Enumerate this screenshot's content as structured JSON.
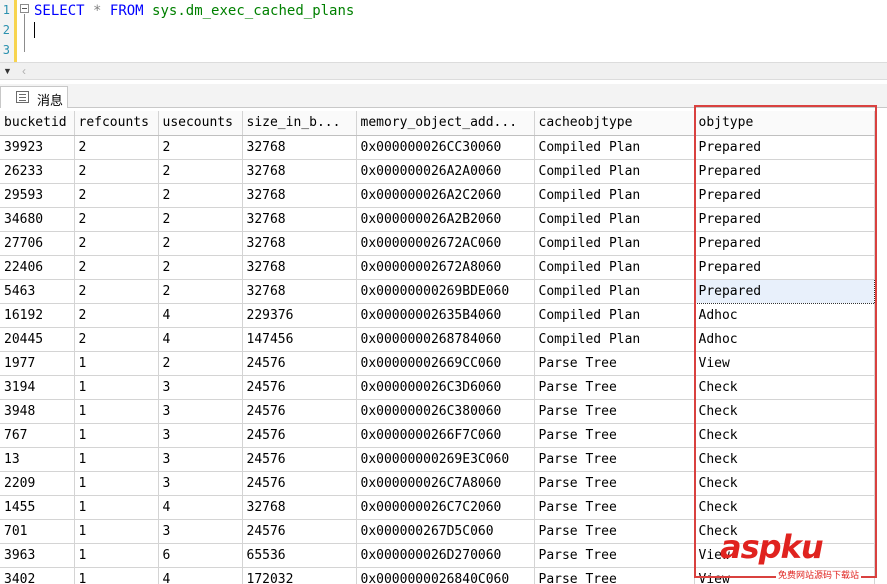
{
  "editor": {
    "line_numbers": [
      "1",
      "2",
      "3"
    ],
    "query": {
      "keyword_select": "SELECT",
      "star": "*",
      "keyword_from": "FROM",
      "object": "sys.dm_exec_cached_plans"
    }
  },
  "results_tab": {
    "label": "消息"
  },
  "grid": {
    "columns": [
      "bucketid",
      "refcounts",
      "usecounts",
      "size_in_b...",
      "memory_object_add...",
      "cacheobjtype",
      "objtype"
    ],
    "rows": [
      [
        "39923",
        "2",
        "2",
        "32768",
        "0x000000026CC30060",
        "Compiled Plan",
        "Prepared"
      ],
      [
        "26233",
        "2",
        "2",
        "32768",
        "0x000000026A2A0060",
        "Compiled Plan",
        "Prepared"
      ],
      [
        "29593",
        "2",
        "2",
        "32768",
        "0x000000026A2C2060",
        "Compiled Plan",
        "Prepared"
      ],
      [
        "34680",
        "2",
        "2",
        "32768",
        "0x000000026A2B2060",
        "Compiled Plan",
        "Prepared"
      ],
      [
        "27706",
        "2",
        "2",
        "32768",
        "0x00000002672AC060",
        "Compiled Plan",
        "Prepared"
      ],
      [
        "22406",
        "2",
        "2",
        "32768",
        "0x00000002672A8060",
        "Compiled Plan",
        "Prepared"
      ],
      [
        "5463",
        "2",
        "2",
        "32768",
        "0x00000000269BDE060",
        "Compiled Plan",
        "Prepared"
      ],
      [
        "16192",
        "2",
        "4",
        "229376",
        "0x00000002635B4060",
        "Compiled Plan",
        "Adhoc"
      ],
      [
        "20445",
        "2",
        "4",
        "147456",
        "0x0000000268784060",
        "Compiled Plan",
        "Adhoc"
      ],
      [
        "1977",
        "1",
        "2",
        "24576",
        "0x00000002669CC060",
        "Parse Tree",
        "View"
      ],
      [
        "3194",
        "1",
        "3",
        "24576",
        "0x000000026C3D6060",
        "Parse Tree",
        "Check"
      ],
      [
        "3948",
        "1",
        "3",
        "24576",
        "0x000000026C380060",
        "Parse Tree",
        "Check"
      ],
      [
        "767",
        "1",
        "3",
        "24576",
        "0x0000000266F7C060",
        "Parse Tree",
        "Check"
      ],
      [
        "13",
        "1",
        "3",
        "24576",
        "0x00000000269E3C060",
        "Parse Tree",
        "Check"
      ],
      [
        "2209",
        "1",
        "3",
        "24576",
        "0x000000026C7A8060",
        "Parse Tree",
        "Check"
      ],
      [
        "1455",
        "1",
        "4",
        "32768",
        "0x000000026C7C2060",
        "Parse Tree",
        "Check"
      ],
      [
        "701",
        "1",
        "3",
        "24576",
        "0x000000267D5C060",
        "Parse Tree",
        "Check"
      ],
      [
        "3963",
        "1",
        "6",
        "65536",
        "0x000000026D270060",
        "Parse Tree",
        "View"
      ],
      [
        "3402",
        "1",
        "4",
        "172032",
        "0x0000000026840C060",
        "Parse Tree",
        "View"
      ]
    ],
    "selected_cell": {
      "row": 6,
      "col": 6
    }
  },
  "watermark": {
    "main": "aspku",
    "sub": "免费网站源码下载站"
  },
  "colors": {
    "keyword": "#0000ff",
    "object": "#008000",
    "highlight_box": "#d9413f",
    "line_number": "#2b91af"
  }
}
